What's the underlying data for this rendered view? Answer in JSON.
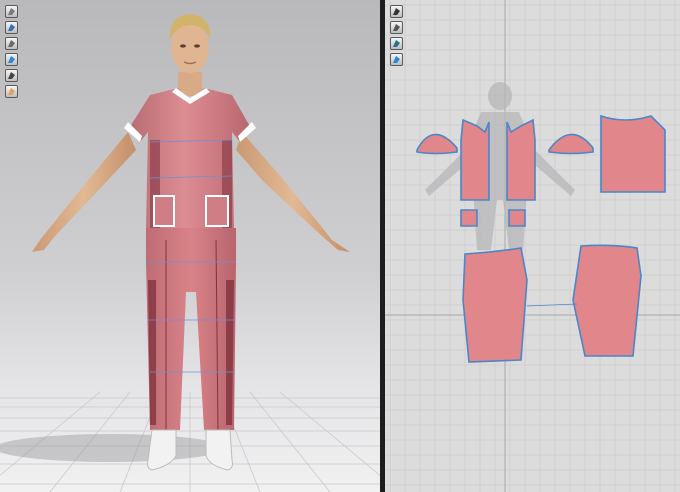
{
  "app": {
    "views": [
      "3d-window",
      "2d-pattern-window"
    ]
  },
  "view3d": {
    "tools": [
      {
        "name": "avatar-display-icon",
        "color": "#7a7a7a"
      },
      {
        "name": "garment-display-icon",
        "color": "#3d6db3"
      },
      {
        "name": "fitting-icon",
        "color": "#6a6a6a"
      },
      {
        "name": "texture-view-icon",
        "color": "#2f86d8"
      },
      {
        "name": "camera-icon",
        "color": "#444444"
      },
      {
        "name": "avatar-skin-icon",
        "color": "#e2a058"
      }
    ]
  },
  "view2d": {
    "tools": [
      {
        "name": "edit-pattern-icon",
        "color": "#333333"
      },
      {
        "name": "transform-pattern-icon",
        "color": "#555555"
      },
      {
        "name": "sewing-icon",
        "color": "#2d6e8a"
      },
      {
        "name": "texture-icon",
        "color": "#2f86d8"
      }
    ]
  },
  "colors": {
    "fabric": "#d98389",
    "fabric_dark": "#b9656d",
    "trim": "#ffffff",
    "pattern_fill": "#e1868b",
    "pattern_outline": "#4a86c8",
    "grid_line": "#c6c6c6",
    "grid_axis": "#a8a8a8"
  }
}
